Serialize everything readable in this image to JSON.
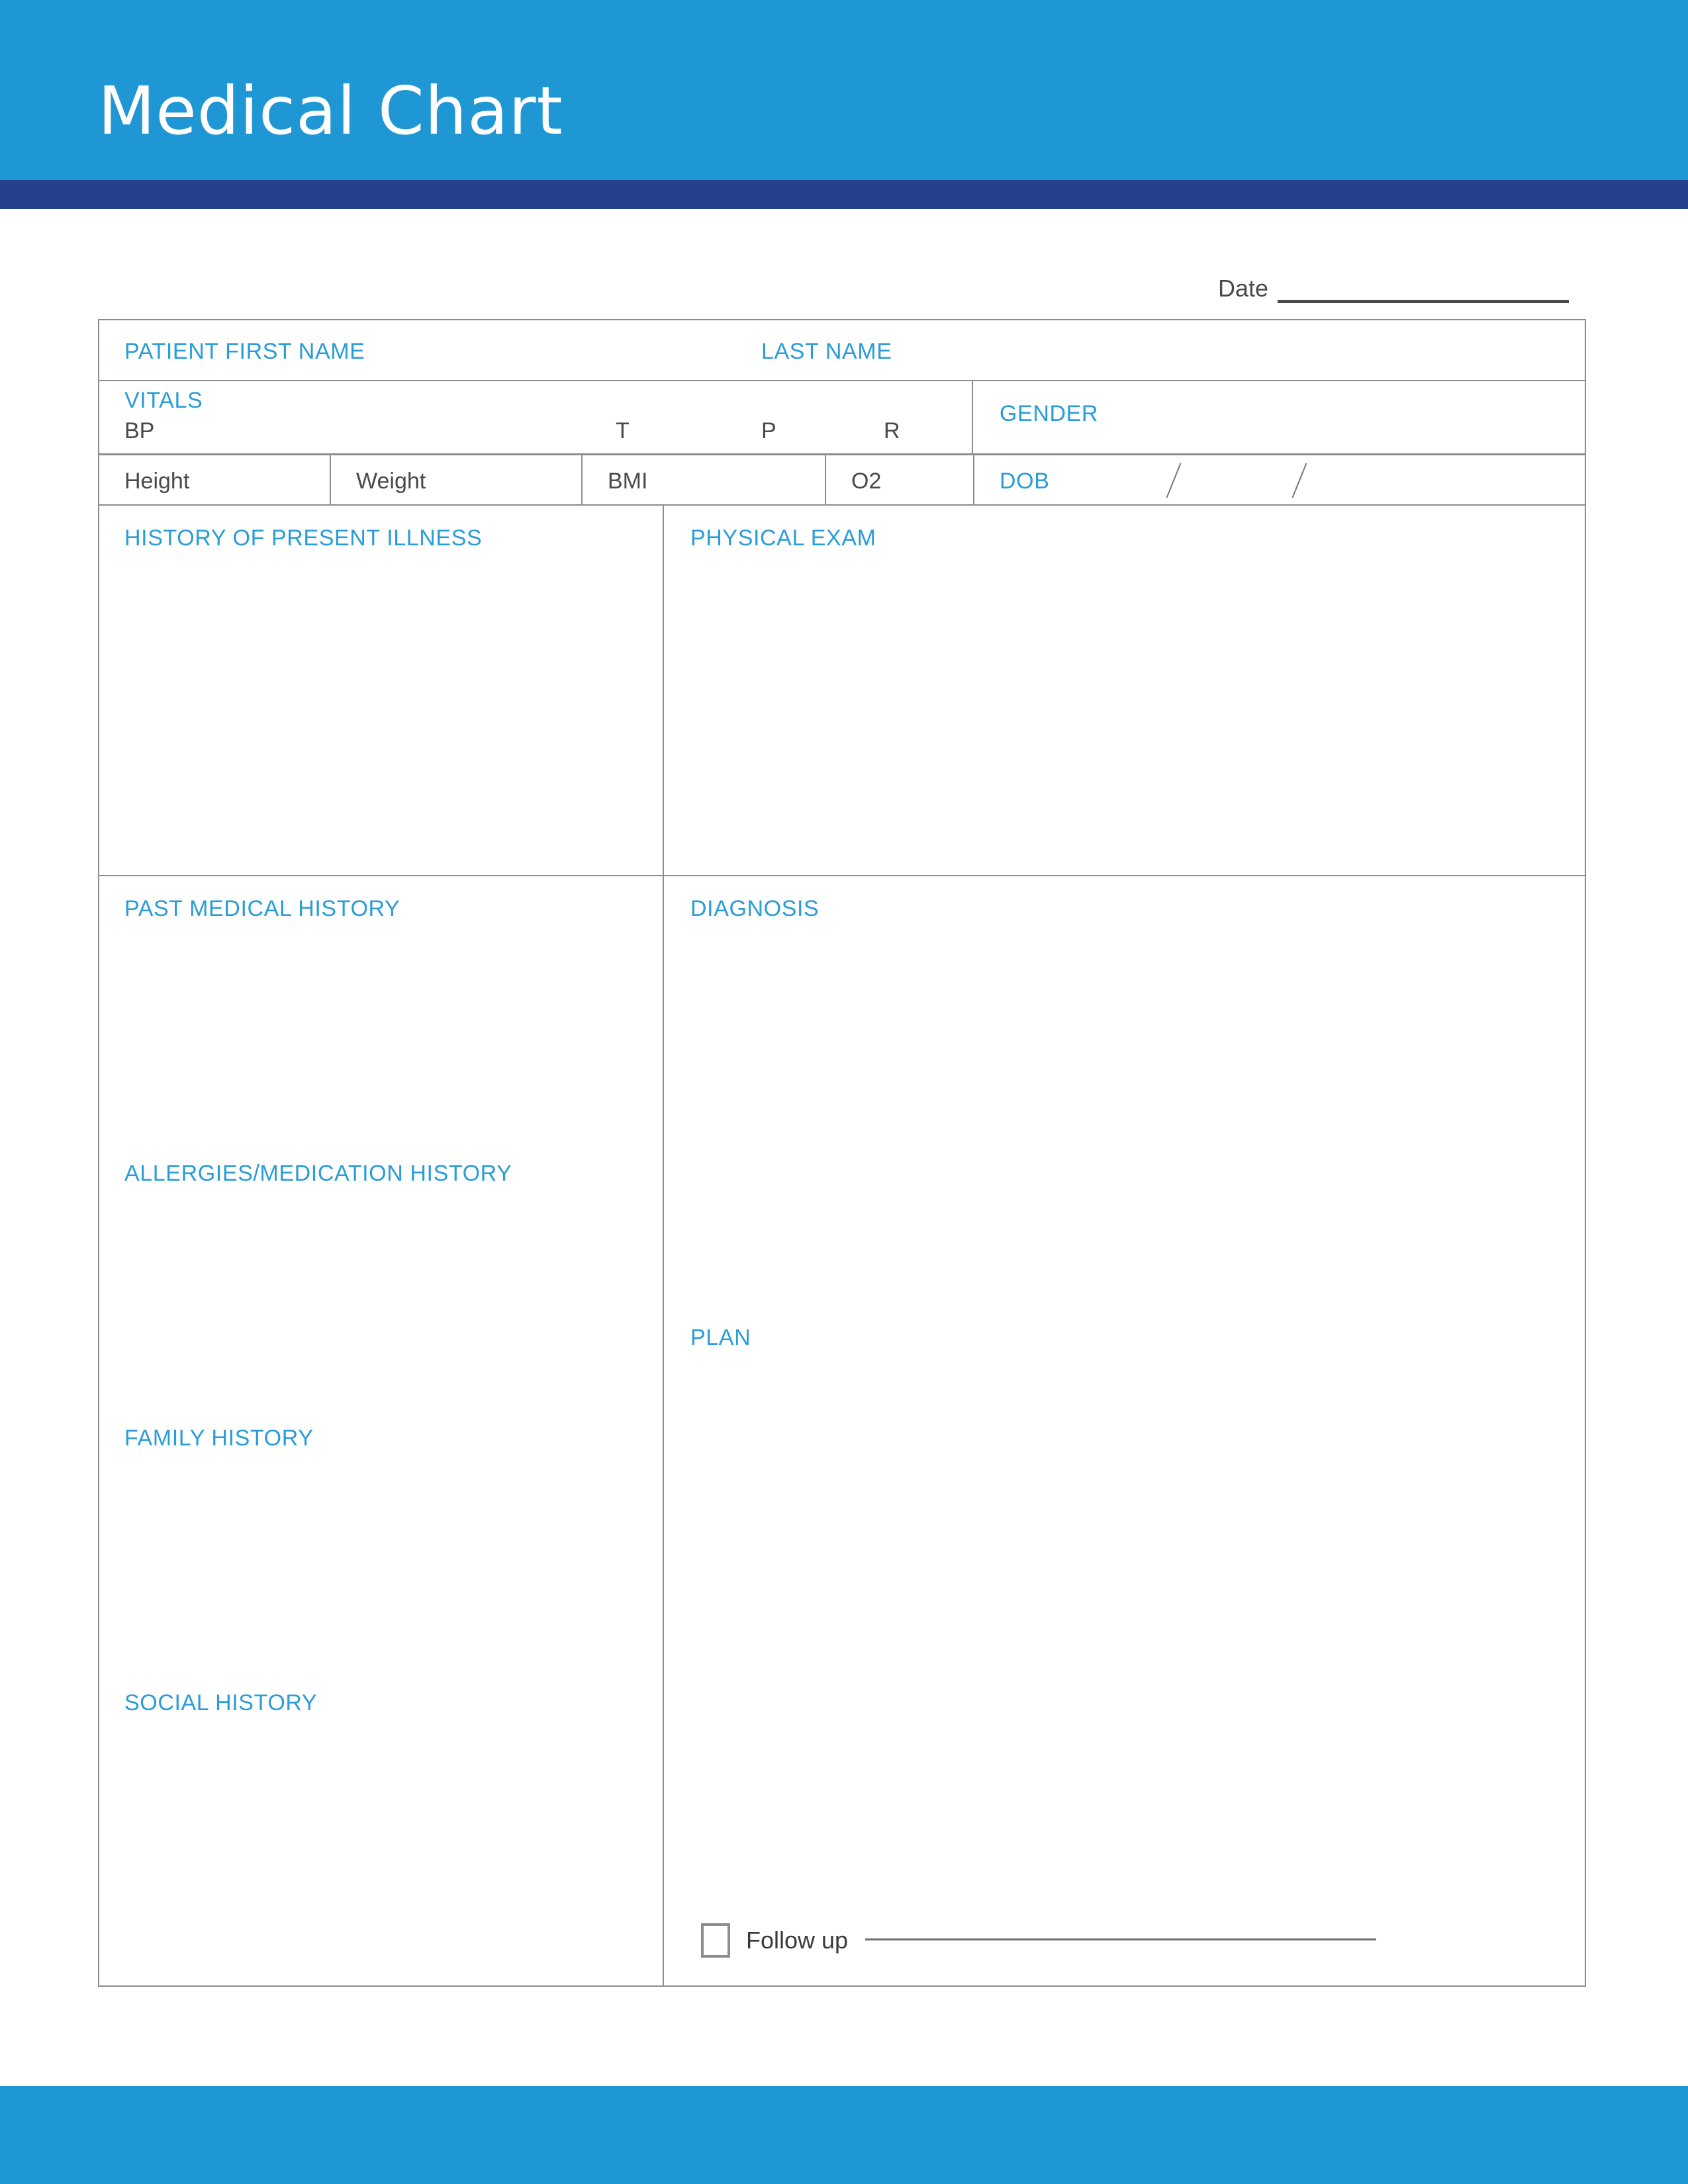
{
  "document": {
    "title": "Medical Chart",
    "accent_blue": "#2a9cd8",
    "header_blue": "#1f97d4",
    "header_navy": "#25418c",
    "border_gray": "#8d8d8d",
    "text_gray": "#4a4a4a"
  },
  "date_field": {
    "label": "Date",
    "value": ""
  },
  "identity": {
    "first_name_label": "PATIENT FIRST NAME",
    "first_name_value": "",
    "last_name_label": "LAST NAME",
    "last_name_value": ""
  },
  "vitals": {
    "section_label": "VITALS",
    "bp_label": "BP",
    "bp_value": "",
    "t_label": "T",
    "t_value": "",
    "p_label": "P",
    "p_value": "",
    "r_label": "R",
    "r_value": "",
    "height_label": "Height",
    "height_value": "",
    "weight_label": "Weight",
    "weight_value": "",
    "bmi_label": "BMI",
    "bmi_value": "",
    "o2_label": "O2",
    "o2_value": ""
  },
  "demographics": {
    "gender_label": "GENDER",
    "gender_value": "",
    "dob_label": "DOB",
    "dob_month": "",
    "dob_day": "",
    "dob_year": "",
    "dob_separator": "/"
  },
  "sections": {
    "history_present_illness": {
      "label": "HISTORY OF PRESENT ILLNESS",
      "value": ""
    },
    "physical_exam": {
      "label": "PHYSICAL EXAM",
      "value": ""
    },
    "past_medical_history": {
      "label": "PAST MEDICAL HISTORY",
      "value": ""
    },
    "allergies_medication_history": {
      "label": "ALLERGIES/MEDICATION HISTORY",
      "value": ""
    },
    "family_history": {
      "label": "FAMILY HISTORY",
      "value": ""
    },
    "social_history": {
      "label": "SOCIAL HISTORY",
      "value": ""
    },
    "diagnosis": {
      "label": "DIAGNOSIS",
      "value": ""
    },
    "plan": {
      "label": "PLAN",
      "value": ""
    }
  },
  "follow_up": {
    "label": "Follow up",
    "checked": false,
    "value": ""
  }
}
